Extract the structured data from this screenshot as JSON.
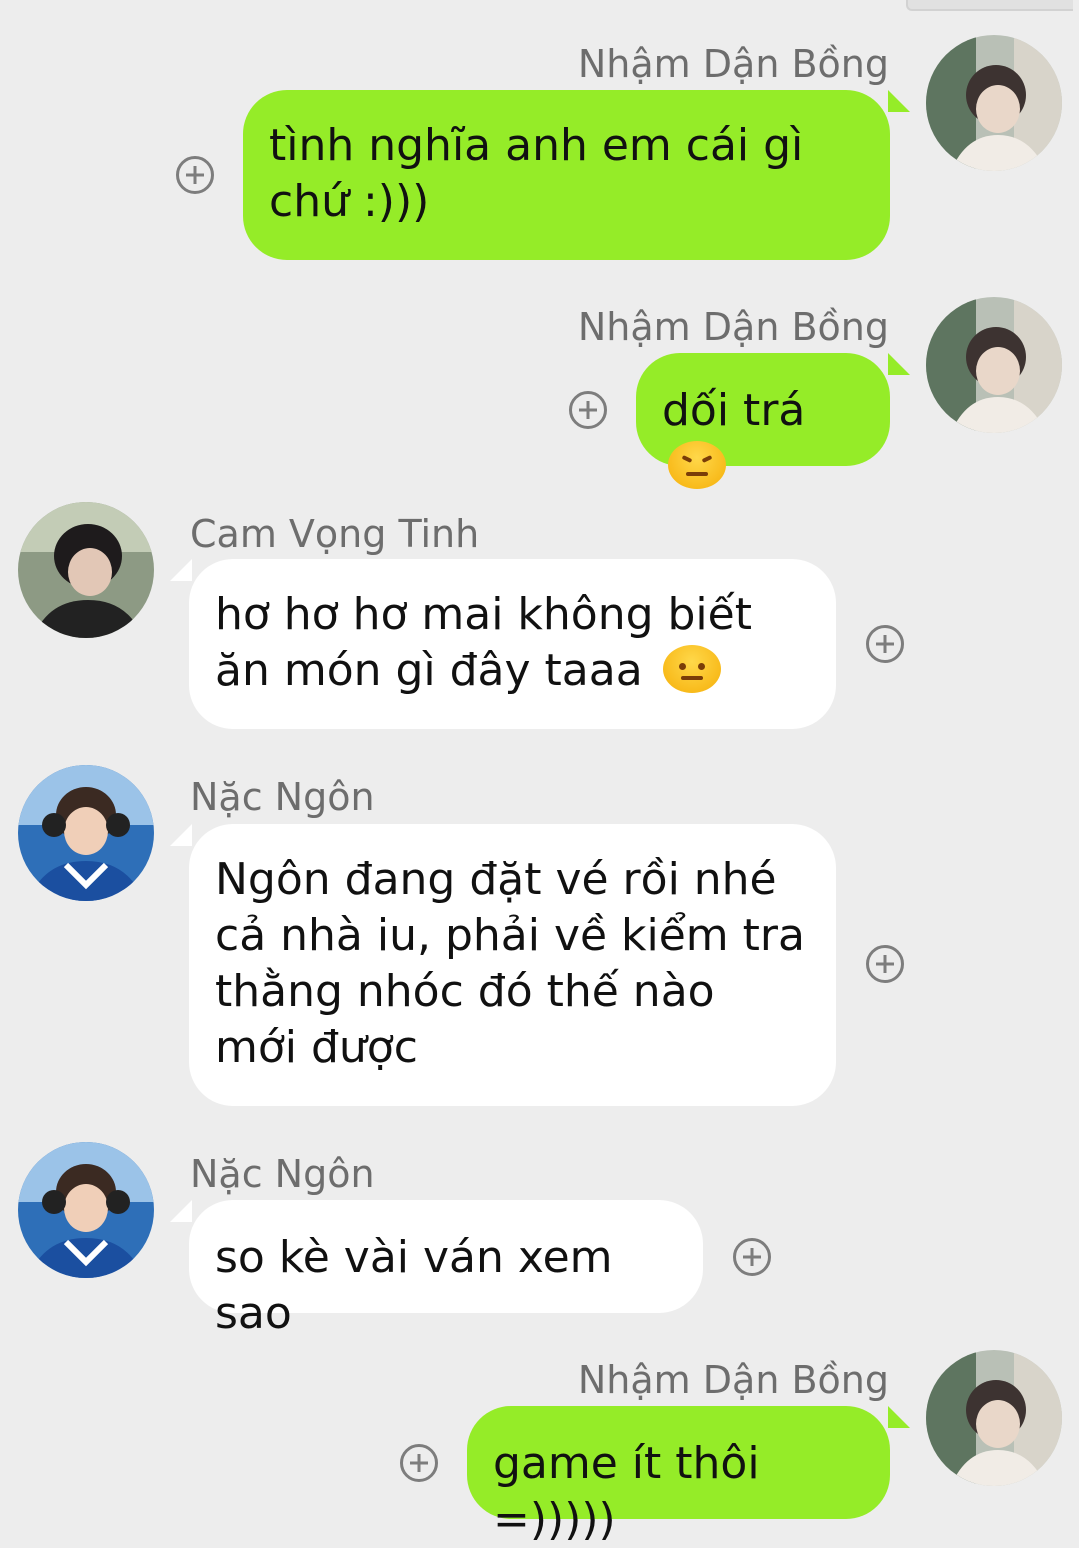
{
  "messages": [
    {
      "sender": "Nhậm Dận Bồng",
      "text": "tình nghĩa anh em cái gì chứ :)))"
    },
    {
      "sender": "Nhậm Dận Bồng",
      "text": "dối trá",
      "emoji": "angry-face-emoji"
    },
    {
      "sender": "Cam Vọng Tinh",
      "text": "hơ hơ hơ mai không biết ăn món gì đây taaa",
      "emoji": "sweat-face-emoji"
    },
    {
      "sender": "Nặc Ngôn",
      "text": "Ngôn đang đặt vé rồi nhé cả nhà iu, phải về kiểm tra thằng nhóc đó thế nào mới được"
    },
    {
      "sender": "Nặc Ngôn",
      "text": "so kè vài ván xem sao"
    },
    {
      "sender": "Nhậm Dận Bồng",
      "text": "game ít thôi =)))))"
    }
  ],
  "colors": {
    "background": "#ededed",
    "outgoing_bubble": "#95ec28",
    "incoming_bubble": "#ffffff",
    "sender_name": "#6d6d6d"
  },
  "icons": {
    "add_reaction": "plus-circle-icon"
  }
}
